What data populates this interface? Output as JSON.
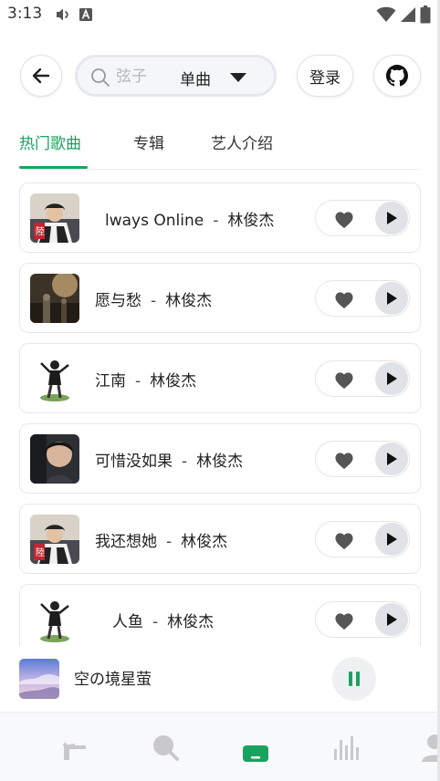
{
  "status_bar": {
    "time": "3:13",
    "left_icons": [
      "volume-icon",
      "font-a-icon"
    ],
    "right_icons": [
      "wifi-icon",
      "cellular-signal-icon",
      "battery-icon"
    ]
  },
  "header": {
    "search": {
      "placeholder": "弦子",
      "value": "",
      "type_label": "单曲"
    },
    "login_label": "登录"
  },
  "tabs": [
    {
      "label": "热门歌曲",
      "active": true
    },
    {
      "label": "专辑",
      "active": false
    },
    {
      "label": "艺人介绍",
      "active": false
    }
  ],
  "songs": [
    {
      "title": "lways Online",
      "artist": "林俊杰"
    },
    {
      "title": "愿与愁",
      "artist": "林俊杰"
    },
    {
      "title": "江南",
      "artist": "林俊杰"
    },
    {
      "title": "可惜没如果",
      "artist": "林俊杰"
    },
    {
      "title": "我还想她",
      "artist": "林俊杰"
    },
    {
      "title": "人鱼",
      "artist": "林俊杰"
    }
  ],
  "song_separator": "-",
  "now_playing": {
    "title": "空の境星萤"
  },
  "colors": {
    "accent": "#1aa35e",
    "icon_gray": "#555555",
    "play_bg": "#dfe2e6"
  },
  "bottom_nav": [
    "home-icon",
    "search-icon",
    "music-library-icon",
    "charts-icon",
    "user-icon"
  ]
}
